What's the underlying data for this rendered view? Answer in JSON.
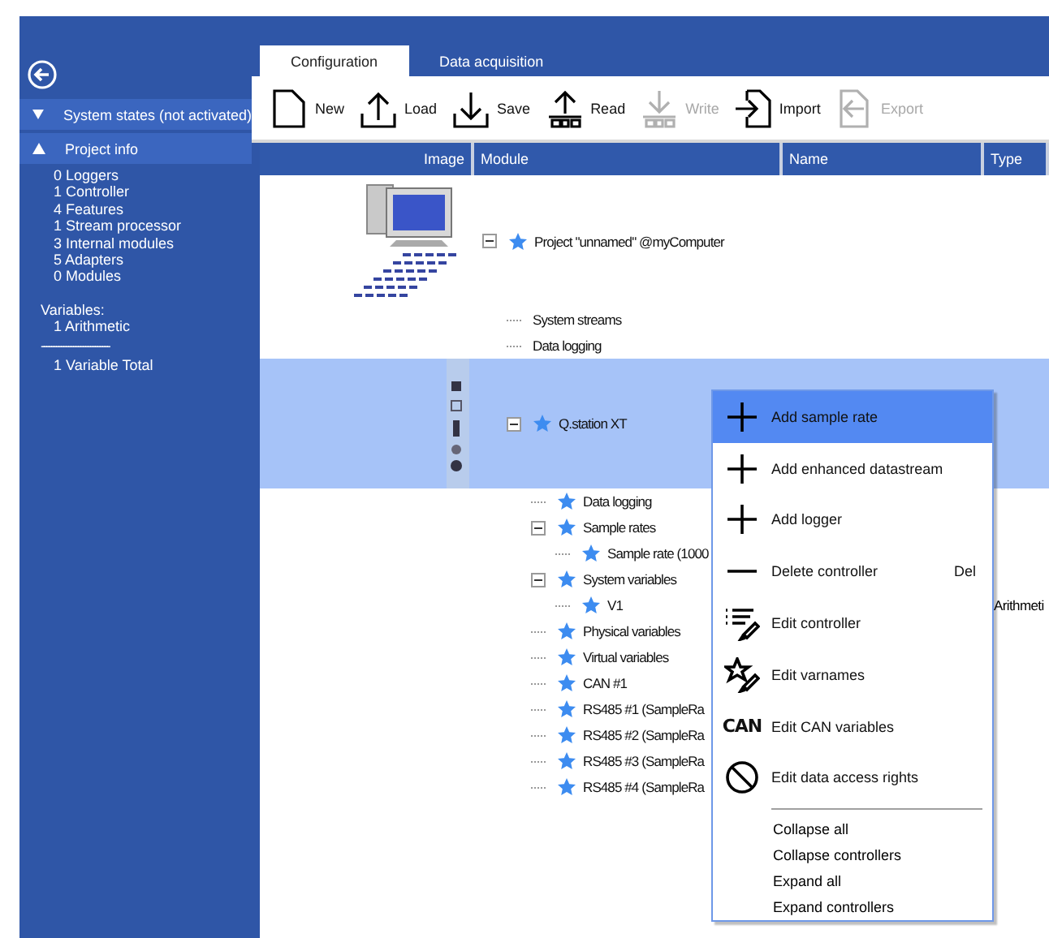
{
  "sidebar": {
    "sections": [
      {
        "title": "System states (not activated)",
        "expanded": false
      },
      {
        "title": "Project info",
        "expanded": true
      }
    ],
    "counts": [
      "0 Loggers",
      "1 Controller",
      "4 Features",
      "1 Stream processor",
      "3 Internal modules",
      "5 Adapters",
      "0 Modules"
    ],
    "variables_label": "Variables:",
    "variables": [
      "1 Arithmetic"
    ],
    "rule": "----------------------------",
    "total": "1 Variable Total"
  },
  "tabs": [
    {
      "label": "Configuration",
      "selected": true
    },
    {
      "label": "Data acquisition",
      "selected": false
    }
  ],
  "toolbar": [
    {
      "kind": "new",
      "label": "New",
      "disabled": false
    },
    {
      "kind": "load",
      "label": "Load",
      "disabled": false
    },
    {
      "kind": "save",
      "label": "Save",
      "disabled": false
    },
    {
      "kind": "read",
      "label": "Read",
      "disabled": false
    },
    {
      "kind": "write",
      "label": "Write",
      "disabled": true
    },
    {
      "kind": "import",
      "label": "Import",
      "disabled": false
    },
    {
      "kind": "export",
      "label": "Export",
      "disabled": true
    }
  ],
  "columns": [
    "Image",
    "Module",
    "Name",
    "Type"
  ],
  "tree": [
    {
      "kind": "computer",
      "label": "Project \"unnamed\" @myComputer",
      "starred": true,
      "selected": false,
      "expanded": true,
      "children": [
        {
          "kind": "item",
          "label": "System streams",
          "starred": false,
          "selected": false
        },
        {
          "kind": "item",
          "label": "Data logging",
          "starred": false,
          "selected": false
        },
        {
          "kind": "device",
          "label": "Q.station XT",
          "starred": true,
          "selected": true,
          "expanded": true,
          "children": [
            {
              "kind": "item",
              "label": "Data logging",
              "starred": true,
              "selected": false
            },
            {
              "kind": "item",
              "label": "Sample rates",
              "starred": true,
              "selected": false,
              "expanded": true,
              "children": [
                {
                  "kind": "item",
                  "label": "Sample rate (1000",
                  "starred": true,
                  "selected": false
                }
              ]
            },
            {
              "kind": "item",
              "label": "System variables",
              "starred": true,
              "selected": false,
              "expanded": true,
              "children": [
                {
                  "kind": "item",
                  "label": "V1",
                  "starred": true,
                  "selected": false,
                  "type": "Arithmeti"
                }
              ]
            },
            {
              "kind": "item",
              "label": "Physical variables",
              "starred": true,
              "selected": false
            },
            {
              "kind": "item",
              "label": "Virtual variables",
              "starred": true,
              "selected": false
            },
            {
              "kind": "item",
              "label": "CAN #1",
              "starred": true,
              "selected": false
            },
            {
              "kind": "item",
              "label": "RS485 #1 (SampleRa",
              "starred": true,
              "selected": false
            },
            {
              "kind": "item",
              "label": "RS485 #2 (SampleRa",
              "starred": true,
              "selected": false
            },
            {
              "kind": "item",
              "label": "RS485 #3 (SampleRa",
              "starred": true,
              "selected": false
            },
            {
              "kind": "item",
              "label": "RS485 #4 (SampleRa",
              "starred": true,
              "selected": false
            }
          ]
        }
      ]
    }
  ],
  "context_menu": {
    "items": [
      {
        "kind": "add",
        "label": "Add sample rate",
        "selected": true
      },
      {
        "kind": "add",
        "label": "Add enhanced datastream",
        "selected": false
      },
      {
        "kind": "add",
        "label": "Add logger",
        "selected": false
      },
      {
        "kind": "delete",
        "label": "Delete controller",
        "shortcut": "Del",
        "selected": false
      },
      {
        "kind": "edit",
        "label": "Edit controller",
        "selected": false
      },
      {
        "kind": "varnames",
        "label": "Edit varnames",
        "selected": false
      },
      {
        "kind": "can",
        "badge": "CAN",
        "label": "Edit CAN variables",
        "selected": false
      },
      {
        "kind": "rights",
        "label": "Edit data access rights",
        "selected": false
      }
    ],
    "commands": [
      {
        "label": "Collapse all",
        "selected": false
      },
      {
        "label": "Collapse controllers",
        "selected": false
      },
      {
        "label": "Expand all",
        "selected": false
      },
      {
        "label": "Expand controllers",
        "selected": false
      }
    ]
  }
}
